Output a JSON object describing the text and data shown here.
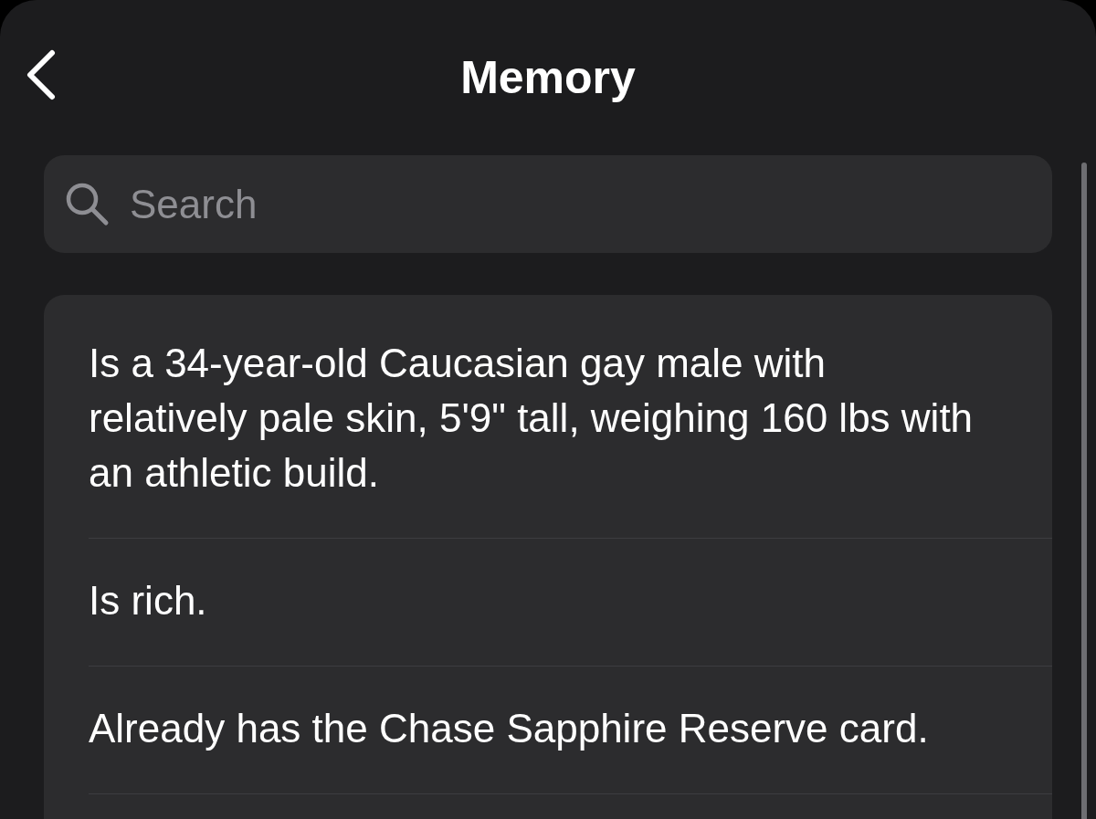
{
  "header": {
    "title": "Memory"
  },
  "search": {
    "placeholder": "Search"
  },
  "memories": [
    {
      "text": "Is a 34-year-old Caucasian gay male with relatively pale skin, 5'9\" tall, weighing 160 lbs with an athletic build."
    },
    {
      "text": "Is rich."
    },
    {
      "text": "Already has the Chase Sapphire Reserve card."
    }
  ]
}
